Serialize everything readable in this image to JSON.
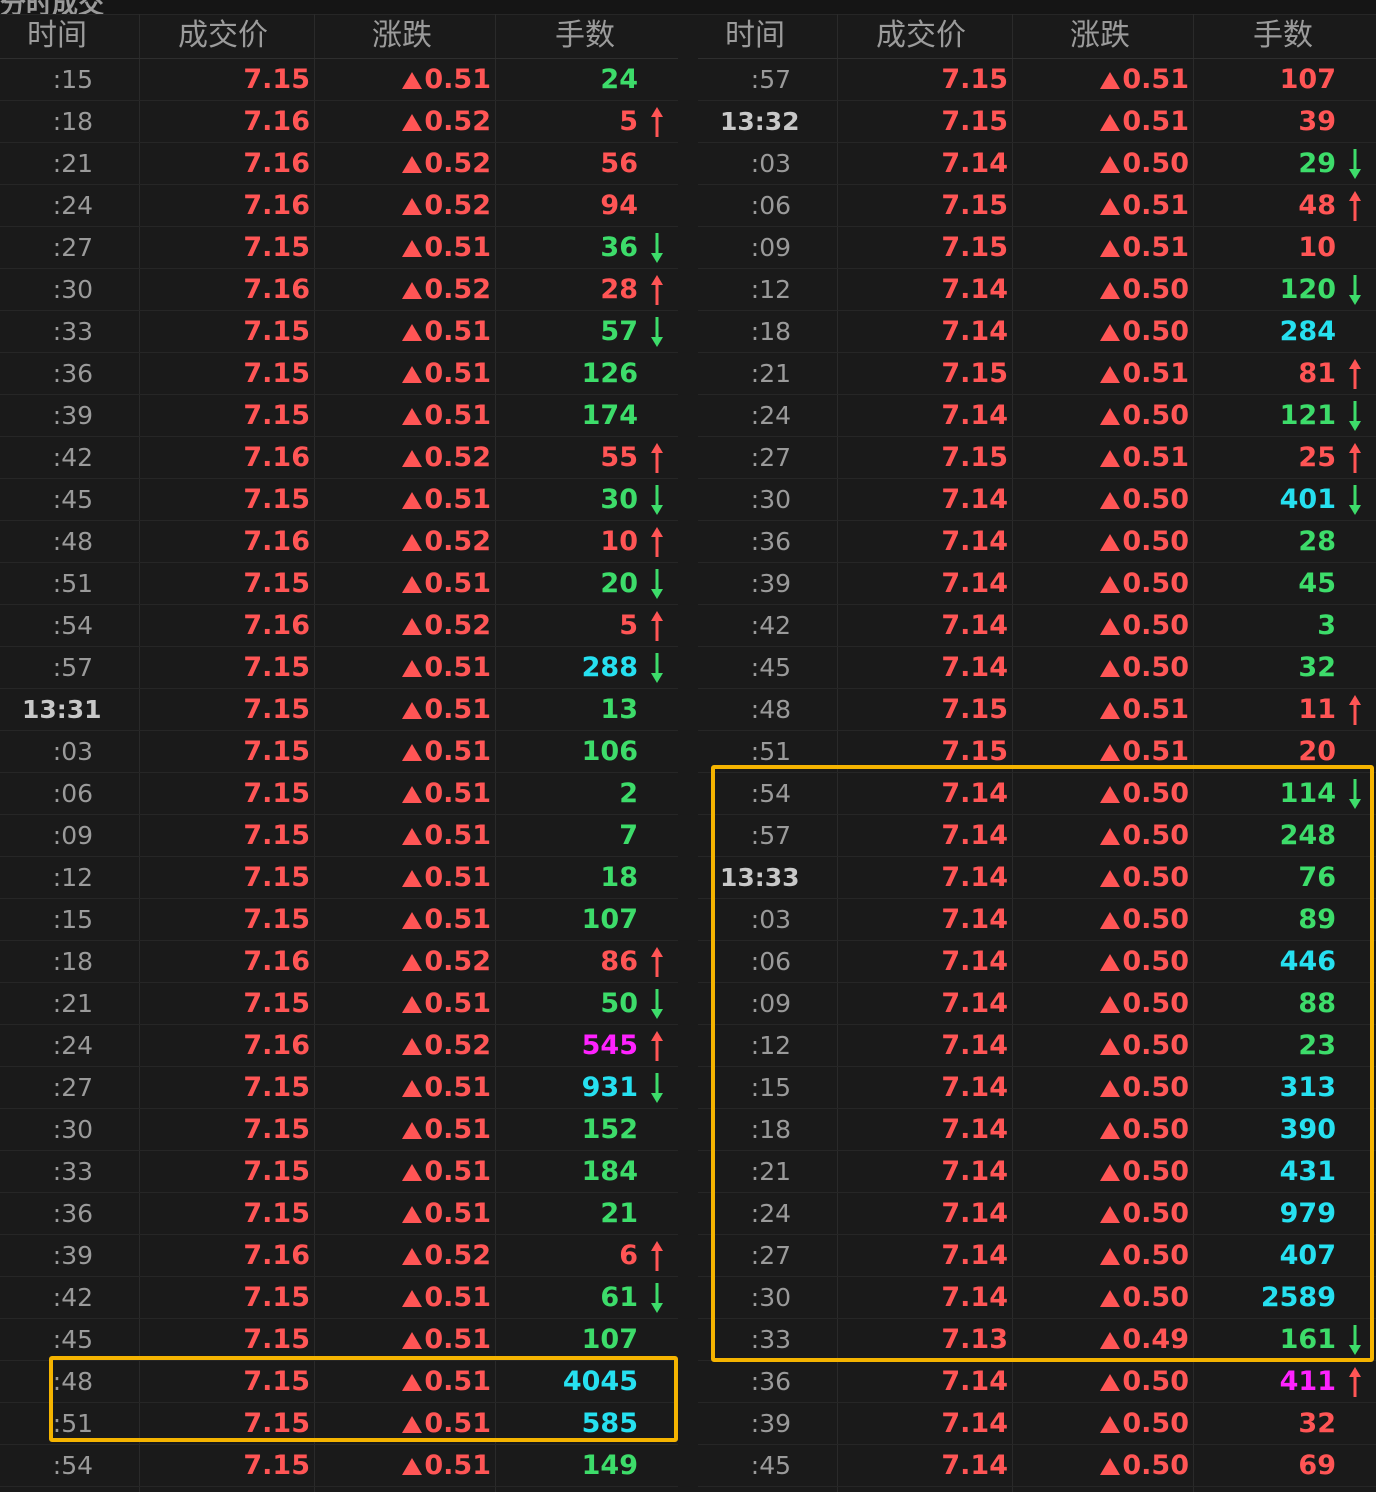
{
  "page_title": "分时成交",
  "colors": {
    "up": "#ff5555",
    "down": "#3ddc6a",
    "large": "#26e0f0",
    "huge": "#ff22ff",
    "header_text": "#9b9b9b",
    "time_text": "#9a9a9a",
    "highlight_border": "#f5b400"
  },
  "headers": {
    "left": {
      "time": "时间",
      "price": "成交价",
      "change": "涨跌",
      "volume": "手数"
    },
    "right": {
      "time": "时间",
      "price": "成交价",
      "change": "涨跌",
      "volume": "手数"
    }
  },
  "left_rows": [
    {
      "time": ":15",
      "price": "7.15",
      "change": "0.51",
      "volume": "24",
      "vol_color": "down",
      "arrow": ""
    },
    {
      "time": ":18",
      "price": "7.16",
      "change": "0.52",
      "volume": "5",
      "vol_color": "up",
      "arrow": "up"
    },
    {
      "time": ":21",
      "price": "7.16",
      "change": "0.52",
      "volume": "56",
      "vol_color": "up",
      "arrow": ""
    },
    {
      "time": ":24",
      "price": "7.16",
      "change": "0.52",
      "volume": "94",
      "vol_color": "up",
      "arrow": ""
    },
    {
      "time": ":27",
      "price": "7.15",
      "change": "0.51",
      "volume": "36",
      "vol_color": "down",
      "arrow": "down"
    },
    {
      "time": ":30",
      "price": "7.16",
      "change": "0.52",
      "volume": "28",
      "vol_color": "up",
      "arrow": "up"
    },
    {
      "time": ":33",
      "price": "7.15",
      "change": "0.51",
      "volume": "57",
      "vol_color": "down",
      "arrow": "down"
    },
    {
      "time": ":36",
      "price": "7.15",
      "change": "0.51",
      "volume": "126",
      "vol_color": "down",
      "arrow": ""
    },
    {
      "time": ":39",
      "price": "7.15",
      "change": "0.51",
      "volume": "174",
      "vol_color": "down",
      "arrow": ""
    },
    {
      "time": ":42",
      "price": "7.16",
      "change": "0.52",
      "volume": "55",
      "vol_color": "up",
      "arrow": "up"
    },
    {
      "time": ":45",
      "price": "7.15",
      "change": "0.51",
      "volume": "30",
      "vol_color": "down",
      "arrow": "down"
    },
    {
      "time": ":48",
      "price": "7.16",
      "change": "0.52",
      "volume": "10",
      "vol_color": "up",
      "arrow": "up"
    },
    {
      "time": ":51",
      "price": "7.15",
      "change": "0.51",
      "volume": "20",
      "vol_color": "down",
      "arrow": "down"
    },
    {
      "time": ":54",
      "price": "7.16",
      "change": "0.52",
      "volume": "5",
      "vol_color": "up",
      "arrow": "up"
    },
    {
      "time": ":57",
      "price": "7.15",
      "change": "0.51",
      "volume": "288",
      "vol_color": "large",
      "arrow": "down"
    },
    {
      "time": "13:31",
      "price": "7.15",
      "change": "0.51",
      "volume": "13",
      "vol_color": "down",
      "arrow": ""
    },
    {
      "time": ":03",
      "price": "7.15",
      "change": "0.51",
      "volume": "106",
      "vol_color": "down",
      "arrow": ""
    },
    {
      "time": ":06",
      "price": "7.15",
      "change": "0.51",
      "volume": "2",
      "vol_color": "down",
      "arrow": ""
    },
    {
      "time": ":09",
      "price": "7.15",
      "change": "0.51",
      "volume": "7",
      "vol_color": "down",
      "arrow": ""
    },
    {
      "time": ":12",
      "price": "7.15",
      "change": "0.51",
      "volume": "18",
      "vol_color": "down",
      "arrow": ""
    },
    {
      "time": ":15",
      "price": "7.15",
      "change": "0.51",
      "volume": "107",
      "vol_color": "down",
      "arrow": ""
    },
    {
      "time": ":18",
      "price": "7.16",
      "change": "0.52",
      "volume": "86",
      "vol_color": "up",
      "arrow": "up"
    },
    {
      "time": ":21",
      "price": "7.15",
      "change": "0.51",
      "volume": "50",
      "vol_color": "down",
      "arrow": "down"
    },
    {
      "time": ":24",
      "price": "7.16",
      "change": "0.52",
      "volume": "545",
      "vol_color": "huge",
      "arrow": "up"
    },
    {
      "time": ":27",
      "price": "7.15",
      "change": "0.51",
      "volume": "931",
      "vol_color": "large",
      "arrow": "down"
    },
    {
      "time": ":30",
      "price": "7.15",
      "change": "0.51",
      "volume": "152",
      "vol_color": "down",
      "arrow": ""
    },
    {
      "time": ":33",
      "price": "7.15",
      "change": "0.51",
      "volume": "184",
      "vol_color": "down",
      "arrow": ""
    },
    {
      "time": ":36",
      "price": "7.15",
      "change": "0.51",
      "volume": "21",
      "vol_color": "down",
      "arrow": ""
    },
    {
      "time": ":39",
      "price": "7.16",
      "change": "0.52",
      "volume": "6",
      "vol_color": "up",
      "arrow": "up"
    },
    {
      "time": ":42",
      "price": "7.15",
      "change": "0.51",
      "volume": "61",
      "vol_color": "down",
      "arrow": "down"
    },
    {
      "time": ":45",
      "price": "7.15",
      "change": "0.51",
      "volume": "107",
      "vol_color": "down",
      "arrow": ""
    },
    {
      "time": ":48",
      "price": "7.15",
      "change": "0.51",
      "volume": "4045",
      "vol_color": "large",
      "arrow": ""
    },
    {
      "time": ":51",
      "price": "7.15",
      "change": "0.51",
      "volume": "585",
      "vol_color": "large",
      "arrow": ""
    },
    {
      "time": ":54",
      "price": "7.15",
      "change": "0.51",
      "volume": "149",
      "vol_color": "down",
      "arrow": ""
    }
  ],
  "right_rows": [
    {
      "time": ":57",
      "price": "7.15",
      "change": "0.51",
      "volume": "107",
      "vol_color": "up",
      "arrow": ""
    },
    {
      "time": "13:32",
      "price": "7.15",
      "change": "0.51",
      "volume": "39",
      "vol_color": "up",
      "arrow": ""
    },
    {
      "time": ":03",
      "price": "7.14",
      "change": "0.50",
      "volume": "29",
      "vol_color": "down",
      "arrow": "down"
    },
    {
      "time": ":06",
      "price": "7.15",
      "change": "0.51",
      "volume": "48",
      "vol_color": "up",
      "arrow": "up"
    },
    {
      "time": ":09",
      "price": "7.15",
      "change": "0.51",
      "volume": "10",
      "vol_color": "up",
      "arrow": ""
    },
    {
      "time": ":12",
      "price": "7.14",
      "change": "0.50",
      "volume": "120",
      "vol_color": "down",
      "arrow": "down"
    },
    {
      "time": ":18",
      "price": "7.14",
      "change": "0.50",
      "volume": "284",
      "vol_color": "large",
      "arrow": ""
    },
    {
      "time": ":21",
      "price": "7.15",
      "change": "0.51",
      "volume": "81",
      "vol_color": "up",
      "arrow": "up"
    },
    {
      "time": ":24",
      "price": "7.14",
      "change": "0.50",
      "volume": "121",
      "vol_color": "down",
      "arrow": "down"
    },
    {
      "time": ":27",
      "price": "7.15",
      "change": "0.51",
      "volume": "25",
      "vol_color": "up",
      "arrow": "up"
    },
    {
      "time": ":30",
      "price": "7.14",
      "change": "0.50",
      "volume": "401",
      "vol_color": "large",
      "arrow": "down"
    },
    {
      "time": ":36",
      "price": "7.14",
      "change": "0.50",
      "volume": "28",
      "vol_color": "down",
      "arrow": ""
    },
    {
      "time": ":39",
      "price": "7.14",
      "change": "0.50",
      "volume": "45",
      "vol_color": "down",
      "arrow": ""
    },
    {
      "time": ":42",
      "price": "7.14",
      "change": "0.50",
      "volume": "3",
      "vol_color": "down",
      "arrow": ""
    },
    {
      "time": ":45",
      "price": "7.14",
      "change": "0.50",
      "volume": "32",
      "vol_color": "down",
      "arrow": ""
    },
    {
      "time": ":48",
      "price": "7.15",
      "change": "0.51",
      "volume": "11",
      "vol_color": "up",
      "arrow": "up"
    },
    {
      "time": ":51",
      "price": "7.15",
      "change": "0.51",
      "volume": "20",
      "vol_color": "up",
      "arrow": ""
    },
    {
      "time": ":54",
      "price": "7.14",
      "change": "0.50",
      "volume": "114",
      "vol_color": "down",
      "arrow": "down"
    },
    {
      "time": ":57",
      "price": "7.14",
      "change": "0.50",
      "volume": "248",
      "vol_color": "down",
      "arrow": ""
    },
    {
      "time": "13:33",
      "price": "7.14",
      "change": "0.50",
      "volume": "76",
      "vol_color": "down",
      "arrow": ""
    },
    {
      "time": ":03",
      "price": "7.14",
      "change": "0.50",
      "volume": "89",
      "vol_color": "down",
      "arrow": ""
    },
    {
      "time": ":06",
      "price": "7.14",
      "change": "0.50",
      "volume": "446",
      "vol_color": "large",
      "arrow": ""
    },
    {
      "time": ":09",
      "price": "7.14",
      "change": "0.50",
      "volume": "88",
      "vol_color": "down",
      "arrow": ""
    },
    {
      "time": ":12",
      "price": "7.14",
      "change": "0.50",
      "volume": "23",
      "vol_color": "down",
      "arrow": ""
    },
    {
      "time": ":15",
      "price": "7.14",
      "change": "0.50",
      "volume": "313",
      "vol_color": "large",
      "arrow": ""
    },
    {
      "time": ":18",
      "price": "7.14",
      "change": "0.50",
      "volume": "390",
      "vol_color": "large",
      "arrow": ""
    },
    {
      "time": ":21",
      "price": "7.14",
      "change": "0.50",
      "volume": "431",
      "vol_color": "large",
      "arrow": ""
    },
    {
      "time": ":24",
      "price": "7.14",
      "change": "0.50",
      "volume": "979",
      "vol_color": "large",
      "arrow": ""
    },
    {
      "time": ":27",
      "price": "7.14",
      "change": "0.50",
      "volume": "407",
      "vol_color": "large",
      "arrow": ""
    },
    {
      "time": ":30",
      "price": "7.14",
      "change": "0.50",
      "volume": "2589",
      "vol_color": "large",
      "arrow": ""
    },
    {
      "time": ":33",
      "price": "7.13",
      "change": "0.49",
      "volume": "161",
      "vol_color": "down",
      "arrow": "down"
    },
    {
      "time": ":36",
      "price": "7.14",
      "change": "0.50",
      "volume": "411",
      "vol_color": "huge",
      "arrow": "up"
    },
    {
      "time": ":39",
      "price": "7.14",
      "change": "0.50",
      "volume": "32",
      "vol_color": "up",
      "arrow": ""
    },
    {
      "time": ":45",
      "price": "7.14",
      "change": "0.50",
      "volume": "69",
      "vol_color": "up",
      "arrow": ""
    }
  ]
}
